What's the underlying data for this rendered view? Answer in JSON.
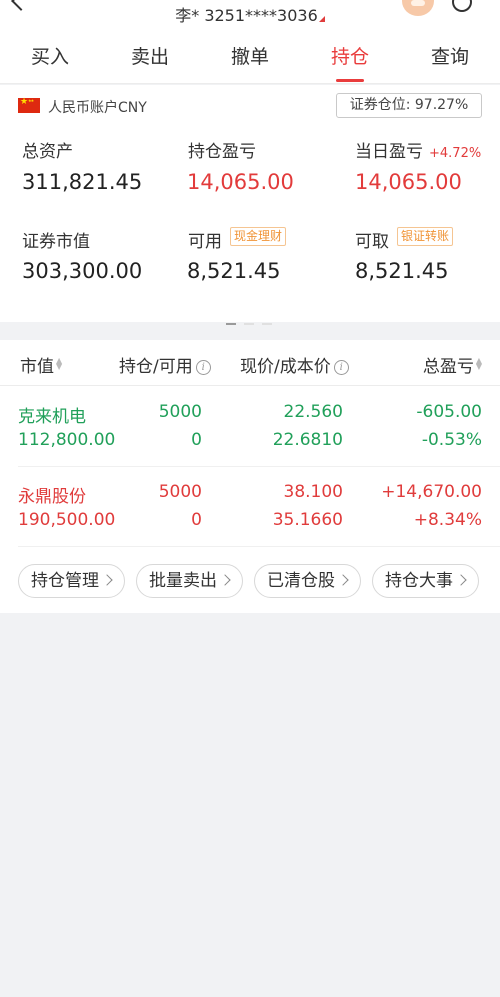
{
  "header": {
    "account_masked": "李* 3251****3036"
  },
  "tabs": [
    {
      "label": "买入"
    },
    {
      "label": "卖出"
    },
    {
      "label": "撤单"
    },
    {
      "label": "持仓",
      "active": true
    },
    {
      "label": "查询"
    }
  ],
  "summary": {
    "account_label": "人民币账户CNY",
    "position_ratio": "证券仓位: 97.27%",
    "total_assets_label": "总资产",
    "total_assets": "311,821.45",
    "holding_pl_label": "持仓盈亏",
    "holding_pl": "14,065.00",
    "daily_pl_label": "当日盈亏",
    "daily_pl_pct": "+4.72%",
    "daily_pl": "14,065.00",
    "market_value_label": "证券市值",
    "market_value": "303,300.00",
    "available_label": "可用",
    "available_tag": "现金理财",
    "available": "8,521.45",
    "withdrawable_label": "可取",
    "withdrawable_tag": "银证转账",
    "withdrawable": "8,521.45"
  },
  "table": {
    "headers": {
      "market_value": "市值",
      "position": "持仓/可用",
      "price": "现价/成本价",
      "total_pl": "总盈亏"
    },
    "rows": [
      {
        "name": "克来机电",
        "market_value": "112,800.00",
        "position": "5000",
        "available": "0",
        "price": "22.560",
        "cost": "22.6810",
        "pl": "-605.00",
        "pl_pct": "-0.53%",
        "trend": "down",
        "color": "#21a05a"
      },
      {
        "name": "永鼎股份",
        "market_value": "190,500.00",
        "position": "5000",
        "available": "0",
        "price": "38.100",
        "cost": "35.1660",
        "pl": "+14,670.00",
        "pl_pct": "+8.34%",
        "trend": "up",
        "color": "#e03c3c"
      }
    ]
  },
  "actions": [
    {
      "label": "持仓管理"
    },
    {
      "label": "批量卖出"
    },
    {
      "label": "已清仓股"
    },
    {
      "label": "持仓大事"
    }
  ],
  "colors": {
    "accent": "#e93c3c",
    "gain": "#e03c3c",
    "loss": "#21a05a",
    "tag": "#f09437"
  }
}
